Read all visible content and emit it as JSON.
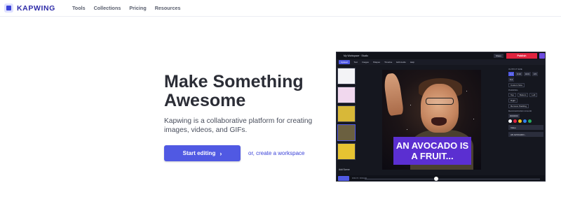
{
  "nav": {
    "brand": "KAPWING",
    "links": [
      "Tools",
      "Collections",
      "Pricing",
      "Resources"
    ]
  },
  "hero": {
    "title": "Make Something Awesome",
    "description": "Kapwing is a collaborative platform for creating images, videos, and GIFs.",
    "cta_label": "Start editing",
    "alt_link": "or, create a workspace"
  },
  "editor": {
    "workspace_title": "My Workspace · Studio",
    "share_label": "Share",
    "publish_label": "Publish",
    "tools": [
      "Upload",
      "Text",
      "Images",
      "Shapes",
      "Timeline",
      "Edit Audio",
      "Help"
    ],
    "add_scene": "Add Scene",
    "meme_caption": "AN AVOCADO IS A FRUIT...",
    "right_panel": {
      "output_size_label": "OUTPUT SIZE",
      "ratios": [
        "1:1",
        "9:16",
        "16:9",
        "4:5",
        "5:4"
      ],
      "custom_size": "Custom Size",
      "padding_label": "PADDING",
      "padding_options": [
        "Top",
        "Bottom",
        "Left",
        "Right"
      ],
      "remove_padding": "Remove Padding",
      "background_label": "BACKGROUND COLOR",
      "color_hex": "#000000",
      "swatches": [
        "#ffffff",
        "#e0243f",
        "#f5c518",
        "#2f80ed",
        "#27ae60"
      ],
      "layers": [
        "Video",
        "AN AVOCADO..."
      ]
    },
    "time_readout": "0:01.5 / 0:04.23"
  },
  "colors": {
    "brand": "#2f2ca8",
    "primary": "#5059e3",
    "publish": "#e0243f",
    "caption_bg": "#5b2fd1"
  }
}
